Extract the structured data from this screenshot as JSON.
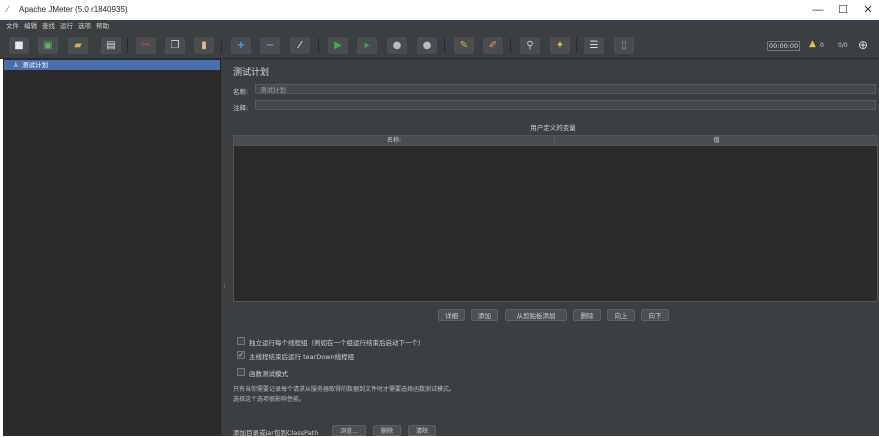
{
  "window": {
    "title": "Apache JMeter (5.0 r1840935)",
    "minimize": "—",
    "maximize": "☐",
    "close": "✕"
  },
  "menu": [
    "文件",
    "编辑",
    "查找",
    "运行",
    "选项",
    "帮助"
  ],
  "toolbar": {
    "icons": [
      "new-icon",
      "templates-icon",
      "open-icon",
      "save-icon",
      "cut-icon",
      "copy-icon",
      "paste-icon",
      "expand-icon",
      "collapse-icon",
      "toggle-icon",
      "start-icon",
      "start-no-pause-icon",
      "stop-icon",
      "shutdown-icon",
      "clear-icon",
      "clear-all-icon",
      "search-icon",
      "reset-search-icon",
      "function-helper-icon",
      "help-icon"
    ],
    "timer": "00:00:00",
    "warning_count": "0",
    "thread_count": "0/0",
    "colors": {
      "add": "#4fa3e0",
      "start": "#3cb043",
      "cut": "#d64541",
      "warn": "#e6c229"
    }
  },
  "tree": {
    "item": "测试计划"
  },
  "plan": {
    "title": "测试计划",
    "name_label": "名称:",
    "name_value": "测试计划",
    "comment_label": "注释:",
    "comment_value": "",
    "vars_title": "用户定义的变量",
    "columns": [
      "名称:",
      "值"
    ],
    "buttons": [
      "详细",
      "添加",
      "从剪贴板添加",
      "删除",
      "向上",
      "向下"
    ],
    "options": [
      {
        "label": "独立运行每个线程组（例如在一个组运行结束后启动下一个）",
        "checked": false
      },
      {
        "label": "主线程结束后运行 tearDown线程组",
        "checked": true
      },
      {
        "label": "函数测试模式",
        "checked": false
      }
    ],
    "note_line1": "只有当你需要记录每个请求从服务器取得的数据到文件时才需要选择函数测试模式。",
    "note_line2": "选择这个选项很影响性能。",
    "classpath_label": "添加目录或jar包到ClassPath",
    "classpath_buttons": [
      "浏览...",
      "删除",
      "清除"
    ]
  }
}
